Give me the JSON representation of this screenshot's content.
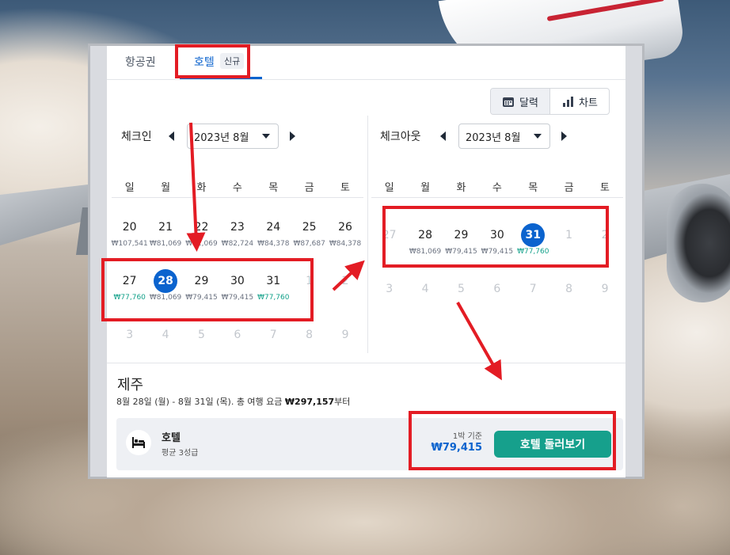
{
  "tabs": {
    "flights": "항공권",
    "hotel": "호텔",
    "new_badge": "신규"
  },
  "view_toggle": {
    "calendar": "달력",
    "chart": "차트"
  },
  "checkin": {
    "label": "체크인",
    "month": "2023년 8월"
  },
  "checkout": {
    "label": "체크아웃",
    "month": "2023년 8월"
  },
  "weekdays": [
    "일",
    "월",
    "화",
    "수",
    "목",
    "금",
    "토"
  ],
  "checkin_calendar": [
    [
      {
        "d": "20",
        "p": "₩107,541"
      },
      {
        "d": "21",
        "p": "₩81,069"
      },
      {
        "d": "22",
        "p": "₩81,069"
      },
      {
        "d": "23",
        "p": "₩82,724"
      },
      {
        "d": "24",
        "p": "₩84,378"
      },
      {
        "d": "25",
        "p": "₩87,687"
      },
      {
        "d": "26",
        "p": "₩84,378"
      }
    ],
    [
      {
        "d": "27",
        "p": "₩77,760",
        "low": true
      },
      {
        "d": "28",
        "p": "₩81,069",
        "sel": true
      },
      {
        "d": "29",
        "p": "₩79,415"
      },
      {
        "d": "30",
        "p": "₩79,415"
      },
      {
        "d": "31",
        "p": "₩77,760",
        "low": true
      },
      {
        "d": "1",
        "dim": true
      },
      {
        "d": "2",
        "dim": true
      }
    ],
    [
      {
        "d": "3",
        "dim": true
      },
      {
        "d": "4",
        "dim": true
      },
      {
        "d": "5",
        "dim": true
      },
      {
        "d": "6",
        "dim": true
      },
      {
        "d": "7",
        "dim": true
      },
      {
        "d": "8",
        "dim": true
      },
      {
        "d": "9",
        "dim": true
      }
    ]
  ],
  "checkout_calendar": [
    [
      {
        "d": "27",
        "dim": true
      },
      {
        "d": "28",
        "p": "₩81,069"
      },
      {
        "d": "29",
        "p": "₩79,415"
      },
      {
        "d": "30",
        "p": "₩79,415"
      },
      {
        "d": "31",
        "p": "₩77,760",
        "low": true,
        "sel": true
      },
      {
        "d": "1",
        "dim": true
      },
      {
        "d": "2",
        "dim": true
      }
    ],
    [
      {
        "d": "3",
        "dim": true
      },
      {
        "d": "4",
        "dim": true
      },
      {
        "d": "5",
        "dim": true
      },
      {
        "d": "6",
        "dim": true
      },
      {
        "d": "7",
        "dim": true
      },
      {
        "d": "8",
        "dim": true
      },
      {
        "d": "9",
        "dim": true
      }
    ]
  ],
  "summary": {
    "destination": "제주",
    "dates": "8월 28일 (월) - 8월 31일 (목). 총 여행 요금 ",
    "total": "₩297,157",
    "total_suffix": "부터"
  },
  "hotel_card": {
    "title": "호텔",
    "subtitle": "평균 3성급",
    "per_night_label": "1박 기준",
    "price": "₩79,415",
    "browse_button": "호텔 둘러보기"
  },
  "colors": {
    "accent": "#0b63ce",
    "cta": "#16a08c",
    "low_price": "#13a18a",
    "annotation": "#e31c24"
  }
}
